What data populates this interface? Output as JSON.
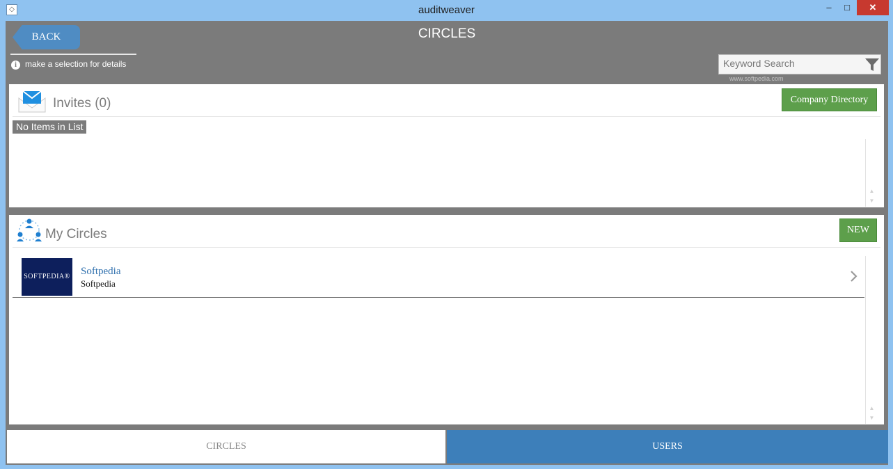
{
  "window": {
    "title": "auditweaver",
    "minimize": "–",
    "maximize": "□",
    "close": "✕"
  },
  "header": {
    "back_label": "BACK",
    "title": "CIRCLES",
    "hint": "make a selection for details",
    "search_placeholder": "Keyword Search",
    "watermark": "www.softpedia.com"
  },
  "invites": {
    "title": "Invites (0)",
    "action_label": "Company Directory",
    "empty_text": "No Items in List"
  },
  "circles": {
    "title": "My Circles",
    "action_label": "NEW",
    "items": [
      {
        "thumb_text": "SOFTPEDIA®",
        "title": "Softpedia",
        "subtitle": "Softpedia"
      }
    ]
  },
  "tabs": [
    {
      "label": "CIRCLES",
      "active": false
    },
    {
      "label": "USERS",
      "active": true
    }
  ],
  "colors": {
    "accent_blue": "#3d7fba",
    "green_button": "#5d9f4b",
    "header_gray": "#7b7b7b",
    "close_red": "#c7392f"
  }
}
